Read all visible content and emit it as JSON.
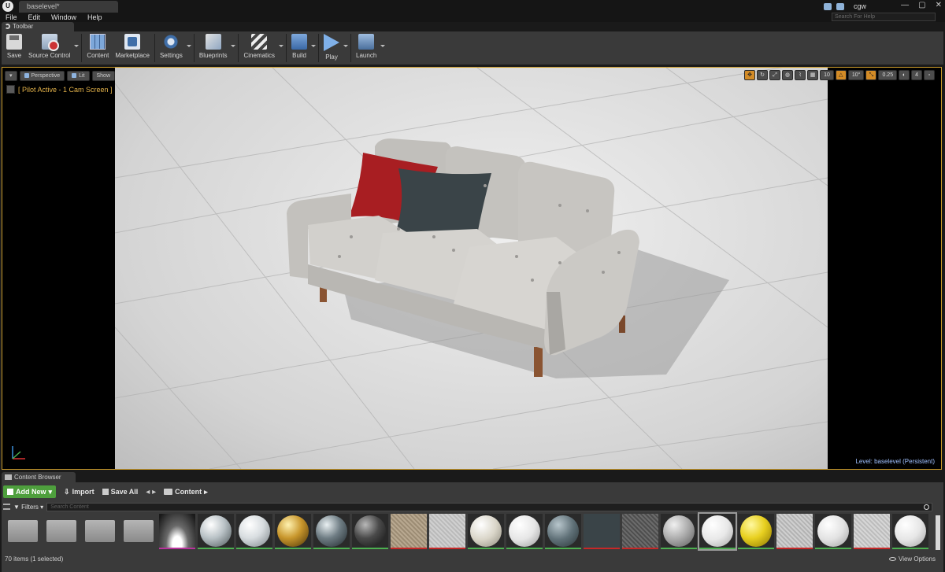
{
  "window": {
    "doc_tab": "baselevel*",
    "user_name": "cgw",
    "controls": [
      "—",
      "▢",
      "✕"
    ],
    "help_search_placeholder": "Search For Help"
  },
  "menu": [
    "File",
    "Edit",
    "Window",
    "Help"
  ],
  "toolbar_tab": "Toolbar",
  "toolbar": {
    "save": "Save",
    "source_control": "Source Control",
    "content": "Content",
    "marketplace": "Marketplace",
    "settings": "Settings",
    "blueprints": "Blueprints",
    "cinematics": "Cinematics",
    "build": "Build",
    "play": "Play",
    "launch": "Launch"
  },
  "viewport": {
    "perspective": "Perspective",
    "lit": "Lit",
    "show": "Show",
    "pilot_text": "[ Pilot Active - 1 Cam Screen ]",
    "grid_snap": "10",
    "rotation_snap": "10°",
    "scale_snap": "0.25",
    "camera_speed": "4",
    "level_label": "Level:",
    "level_value": "baselevel (Persistent)",
    "colors": {
      "sofa_fabric": "#c9c7c3",
      "red_pillow": "#a81e22",
      "dark_pillow": "#3a4448",
      "legs": "#8a5432",
      "selection_border": "#c99a2a"
    }
  },
  "content_browser": {
    "tab": "Content Browser",
    "add_new": "Add New",
    "import": "Import",
    "save_all": "Save All",
    "path": "Content",
    "filters": "Filters",
    "search_placeholder": "Search Content",
    "status": "70 items (1 selected)",
    "view_options": "View Options"
  },
  "assets": [
    {
      "type": "folder"
    },
    {
      "type": "folder"
    },
    {
      "type": "folder"
    },
    {
      "type": "folder"
    },
    {
      "type": "sky",
      "accent": "#b8339c"
    },
    {
      "type": "sphere",
      "fill": "radial-gradient(circle at 35% 30%, #ffffff, #b9c2c6 45%, #4c5558)",
      "accent": "#4caf50"
    },
    {
      "type": "sphere",
      "fill": "radial-gradient(circle at 35% 30%, #ffffff, #d8dde0 45%, #7a8286)",
      "accent": "#4caf50"
    },
    {
      "type": "sphere",
      "fill": "radial-gradient(circle at 35% 30%, #fff2b0, #c8962c 45%, #4a3206)",
      "accent": "#4caf50"
    },
    {
      "type": "sphere",
      "fill": "radial-gradient(circle at 35% 30%, #e9f0f2, #6f7d84 45%, #1f272b)",
      "accent": "#4caf50"
    },
    {
      "type": "sphere",
      "fill": "radial-gradient(circle at 35% 30%, #b8b8b8, #4a4a4a 45%, #111111)",
      "accent": "#4caf50"
    },
    {
      "type": "texture",
      "fill": "repeating-linear-gradient(45deg,#b8a890 0 2px,#9c8c74 2px 4px)",
      "accent": "#c62828"
    },
    {
      "type": "texture",
      "fill": "repeating-linear-gradient(45deg,#d0d0d0 0 2px,#bababa 2px 4px)",
      "accent": "#c62828"
    },
    {
      "type": "sphere",
      "fill": "radial-gradient(circle at 35% 30%, #ffffff, #d9d5c8 50%, #8d897c)",
      "accent": "#4caf50"
    },
    {
      "type": "sphere",
      "fill": "radial-gradient(circle at 35% 30%, #ffffff, #e6e6e6 50%, #9a9a9a)",
      "accent": "#4caf50"
    },
    {
      "type": "sphere",
      "fill": "radial-gradient(circle at 35% 30%, #b8c6cc, #5f7077 50%, #2a3538)",
      "accent": "#4caf50"
    },
    {
      "type": "texture",
      "fill": "#3a4448",
      "accent": "#c62828"
    },
    {
      "type": "texture",
      "fill": "repeating-linear-gradient(45deg,#6b6b6b 0 2px,#4e4e4e 2px 4px)",
      "accent": "#c62828"
    },
    {
      "type": "sphere",
      "fill": "radial-gradient(circle at 35% 30%, #f0f0f0, #a8a8a8 50%, #5a5a5a)",
      "accent": "#4caf50"
    },
    {
      "type": "sphere",
      "fill": "radial-gradient(circle at 35% 30%, #ffffff, #e8e8e8 50%, #a6a6a6)",
      "accent": "#4caf50",
      "selected": true
    },
    {
      "type": "sphere",
      "fill": "radial-gradient(circle at 35% 30%, #fff8a0, #e8d020 45%, #8a7400)",
      "accent": "#4caf50"
    },
    {
      "type": "texture",
      "fill": "repeating-linear-gradient(45deg,#cfcfcf 0 2px,#b3b3b3 2px 4px)",
      "accent": "#c62828"
    },
    {
      "type": "sphere",
      "fill": "radial-gradient(circle at 35% 30%, #ffffff, #e2e2e2 50%, #a0a0a0)",
      "accent": "#4caf50"
    },
    {
      "type": "texture",
      "fill": "repeating-linear-gradient(45deg,#d6d6d6 0 2px,#bdbdbd 2px 4px)",
      "accent": "#c62828"
    },
    {
      "type": "sphere",
      "fill": "radial-gradient(circle at 35% 30%, #ffffff, #e6e6e6 50%, #a4a4a4)",
      "accent": "#4caf50"
    }
  ]
}
